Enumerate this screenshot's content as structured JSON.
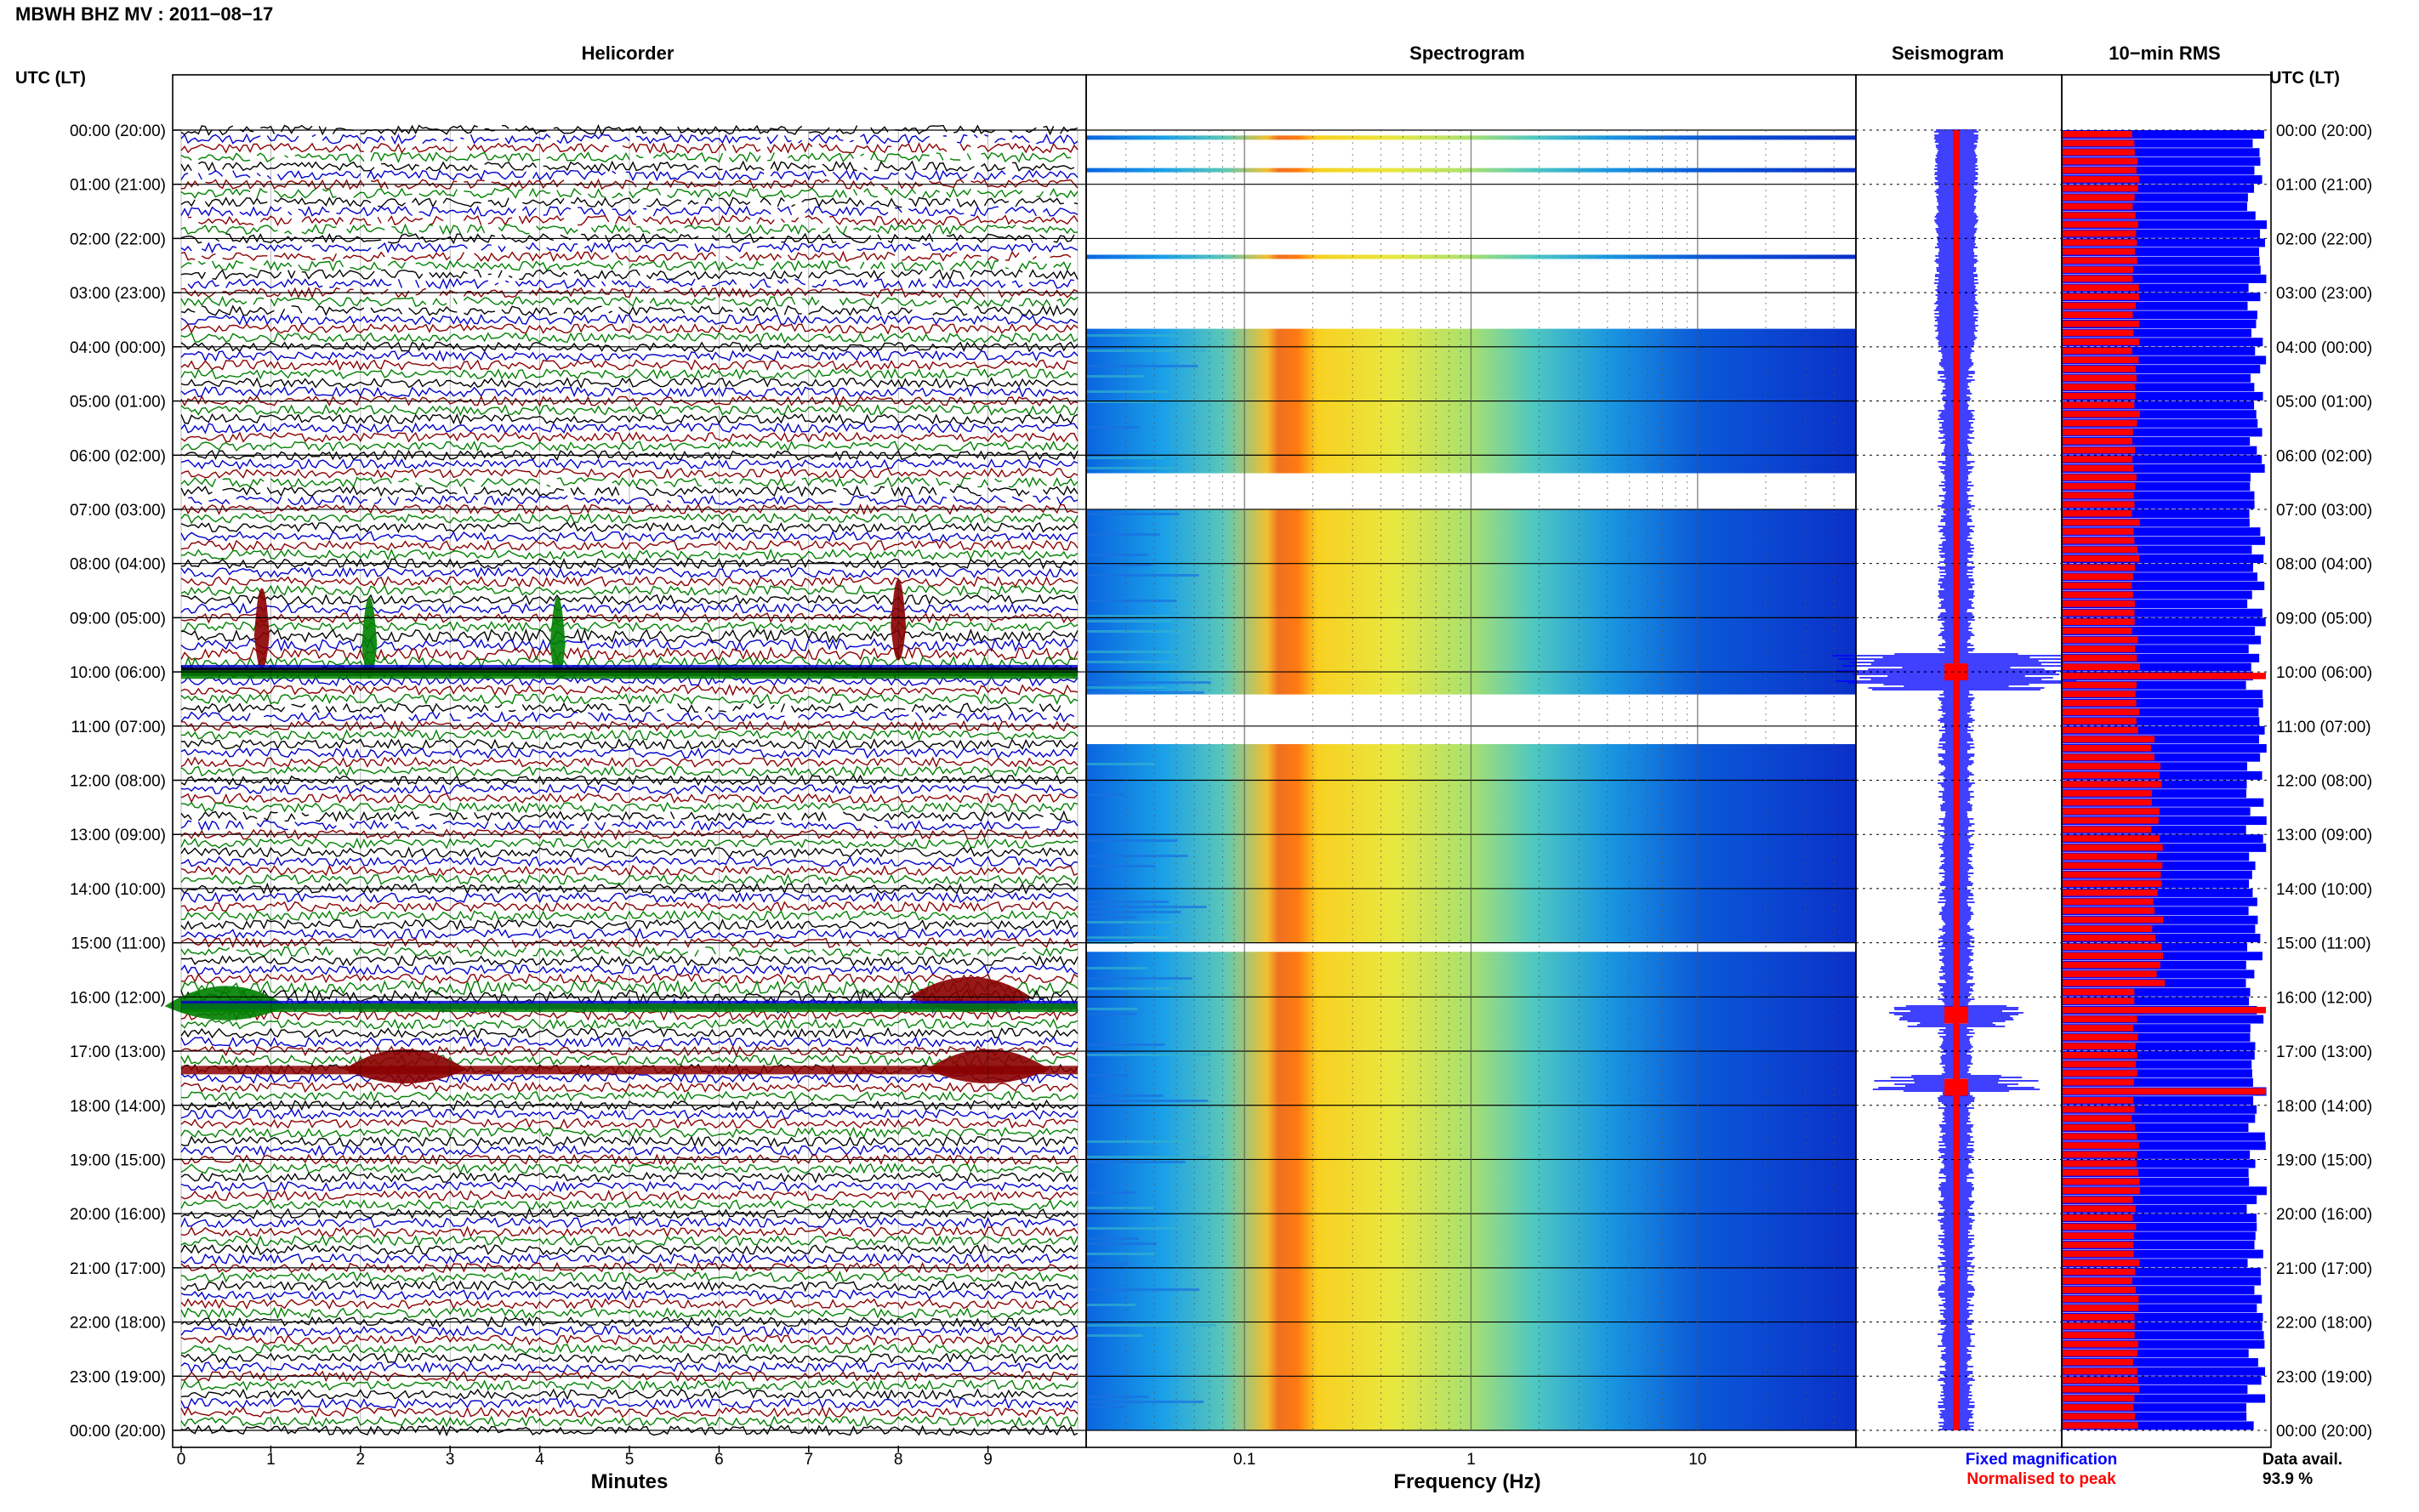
{
  "header": {
    "station": "MBWH BHZ MV : 2011−08−17",
    "utc_label": "UTC (LT)"
  },
  "panels": {
    "helicorder": "Helicorder",
    "spectrogram": "Spectrogram",
    "seismogram": "Seismogram",
    "rms": "10−min RMS"
  },
  "axis": {
    "helicorder_xlabel": "Minutes",
    "spectrogram_xlabel": "Frequency (Hz)"
  },
  "legend": {
    "fixed": "Fixed magnification",
    "normalised": "Normalised to peak",
    "avail_label": "Data avail.",
    "avail_value": "93.9 %"
  },
  "colors": {
    "trace_cycle": [
      "#000000",
      "#0000cc",
      "#8b0000",
      "#008000"
    ],
    "fixed": "#0000ff",
    "normalised": "#ff0000"
  },
  "chart_data": [
    {
      "type": "line",
      "panel": "helicorder",
      "xlabel": "Minutes",
      "xlim": [
        0,
        10
      ],
      "x_ticks": [
        "0",
        "1",
        "2",
        "3",
        "4",
        "5",
        "6",
        "7",
        "8",
        "9"
      ],
      "y_ticks_left": [
        "00:00 (20:00)",
        "01:00 (21:00)",
        "02:00 (22:00)",
        "03:00 (23:00)",
        "04:00 (00:00)",
        "05:00 (01:00)",
        "06:00 (02:00)",
        "07:00 (03:00)",
        "08:00 (04:00)",
        "09:00 (05:00)",
        "10:00 (06:00)",
        "11:00 (07:00)",
        "12:00 (08:00)",
        "13:00 (09:00)",
        "14:00 (10:00)",
        "15:00 (11:00)",
        "16:00 (12:00)",
        "17:00 (13:00)",
        "18:00 (14:00)",
        "19:00 (15:00)",
        "20:00 (16:00)",
        "21:00 (17:00)",
        "22:00 (18:00)",
        "23:00 (19:00)",
        "00:00 (20:00)"
      ],
      "rows_per_hour": 6,
      "events": [
        {
          "time": "09:30",
          "minute": 2.1,
          "color": "green"
        },
        {
          "time": "09:30",
          "minute": 4.2,
          "color": "green"
        },
        {
          "time": "09:20",
          "minute": 0.9,
          "color": "darkred"
        },
        {
          "time": "09:10",
          "minute": 8.0,
          "color": "darkred"
        },
        {
          "time": "16:10",
          "minute": 0.5,
          "color": "green"
        },
        {
          "time": "16:00",
          "minute": 8.8,
          "color": "darkred"
        },
        {
          "time": "17:20",
          "minute": 2.5,
          "color": "darkred"
        },
        {
          "time": "17:20",
          "minute": 9.0,
          "color": "darkred"
        }
      ]
    },
    {
      "type": "heatmap",
      "panel": "spectrogram",
      "xlabel": "Frequency (Hz)",
      "xscale": "log",
      "xlim": [
        0.02,
        50
      ],
      "x_ticks": [
        "0.1",
        "1",
        "10"
      ],
      "peak_band_hz": [
        0.22,
        0.3
      ],
      "data_gaps_utc": [
        [
          "00:00",
          "03:40"
        ],
        [
          "06:20",
          "07:00"
        ],
        [
          "10:25",
          "11:20"
        ],
        [
          "15:00",
          "15:10"
        ]
      ]
    },
    {
      "type": "line",
      "panel": "seismogram",
      "series": [
        {
          "name": "Fixed magnification"
        },
        {
          "name": "Normalised to peak"
        }
      ],
      "events_utc": [
        "10:00",
        "16:20",
        "17:40"
      ]
    },
    {
      "type": "bar",
      "panel": "rms",
      "orientation": "horizontal",
      "series": [
        {
          "name": "Fixed magnification"
        },
        {
          "name": "Normalised to peak"
        }
      ],
      "spikes_utc": [
        "10:00",
        "16:10",
        "17:40"
      ],
      "data_availability_percent": 93.9
    }
  ]
}
